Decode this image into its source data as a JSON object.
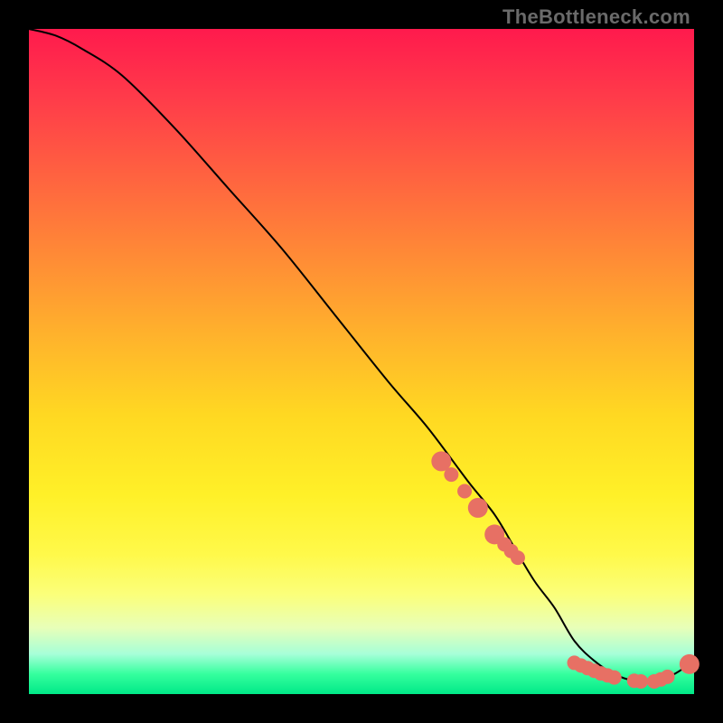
{
  "watermark": "TheBottleneck.com",
  "chart_data": {
    "type": "line",
    "title": "",
    "xlabel": "",
    "ylabel": "",
    "x_range": [
      0,
      100
    ],
    "y_range": [
      0,
      100
    ],
    "background_gradient": {
      "top": "#ff1a4d",
      "mid": "#ffe030",
      "bottom": "#00e888"
    },
    "series": [
      {
        "name": "main-curve",
        "x": [
          0,
          4,
          8,
          14,
          22,
          30,
          38,
          46,
          54,
          60,
          66,
          70,
          73,
          76,
          79,
          82,
          85,
          88,
          91,
          94,
          97,
          100
        ],
        "values": [
          100,
          99,
          97,
          93,
          85,
          76,
          67,
          57,
          47,
          40,
          32,
          27,
          22,
          17,
          13,
          8,
          5,
          3,
          2,
          2,
          3,
          5
        ]
      }
    ],
    "markers": {
      "name": "highlight-points",
      "x": [
        62,
        63.5,
        65.5,
        67.5,
        70,
        71.5,
        72.5,
        73.5,
        82,
        83,
        84,
        85,
        86,
        87,
        88,
        91,
        92,
        94,
        95,
        96,
        99.3
      ],
      "values": [
        35,
        33,
        30.5,
        28,
        24,
        22.5,
        21.5,
        20.5,
        4.7,
        4.3,
        3.9,
        3.5,
        3.1,
        2.8,
        2.5,
        2.0,
        1.9,
        1.9,
        2.2,
        2.6,
        4.5
      ],
      "radius": [
        11,
        8,
        8,
        11,
        11,
        8,
        8,
        8,
        8,
        8,
        8,
        8,
        8,
        8,
        8,
        8,
        8,
        8,
        8,
        8,
        11
      ]
    }
  }
}
